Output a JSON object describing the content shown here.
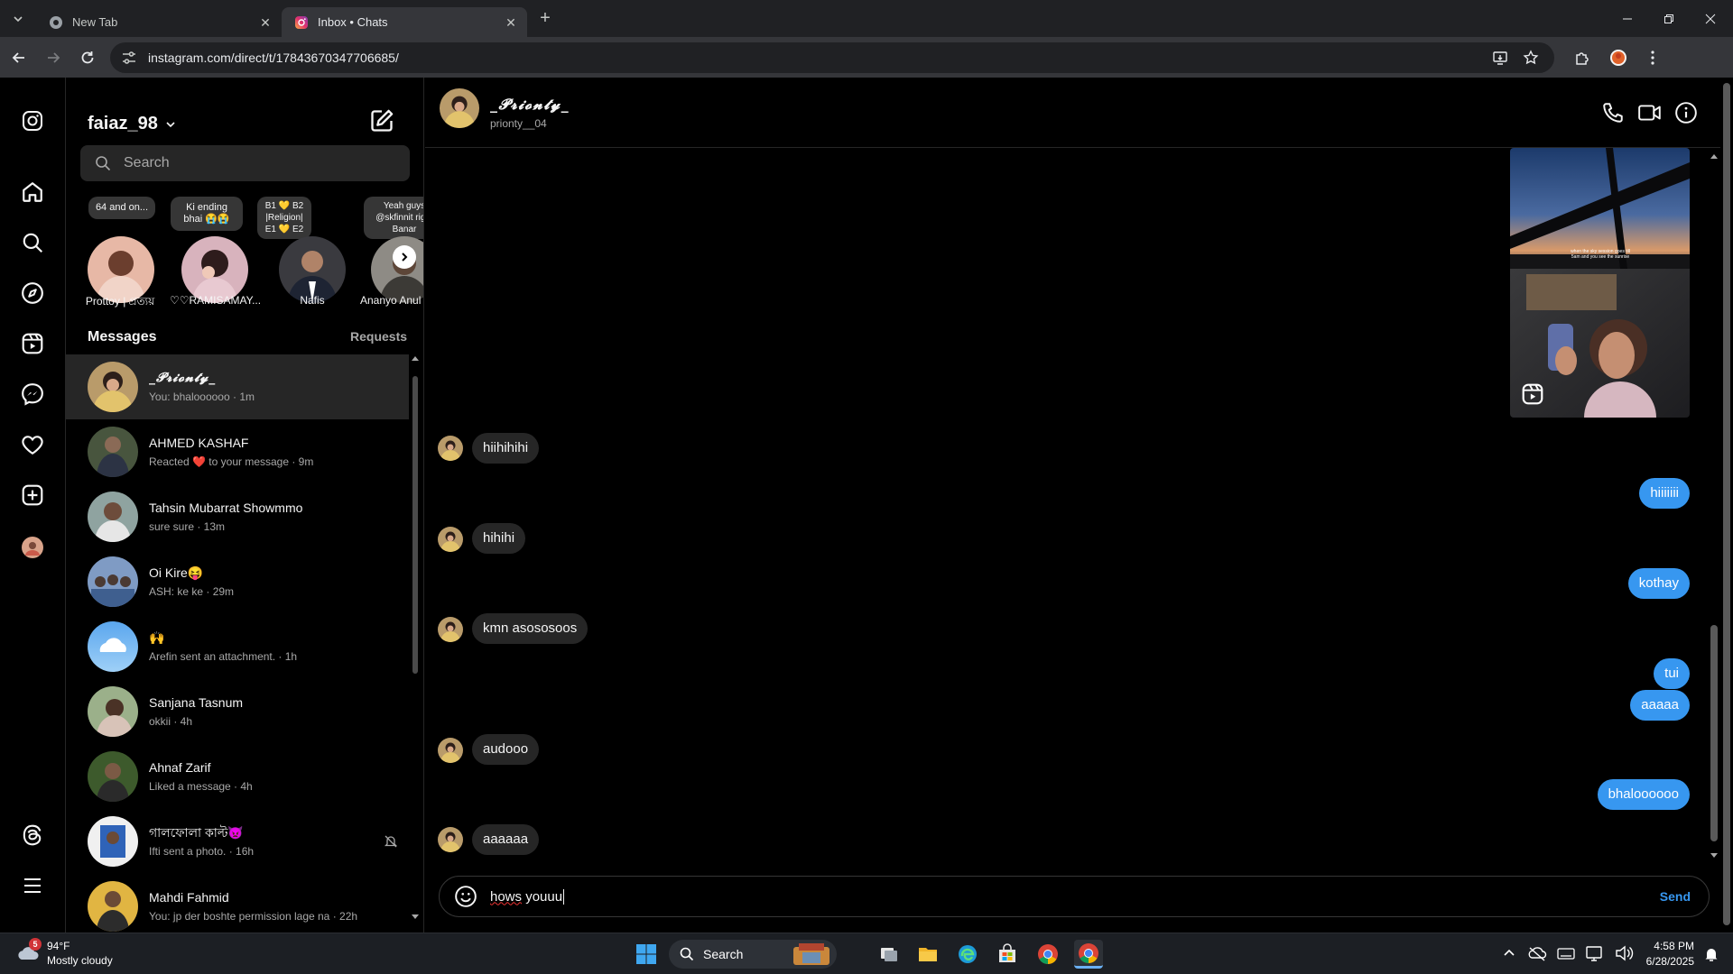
{
  "browser": {
    "tabs": [
      {
        "title": "New Tab",
        "active": false,
        "icon": "chrome-icon"
      },
      {
        "title": "Inbox • Chats",
        "active": true,
        "icon": "instagram-icon"
      }
    ],
    "url": "instagram.com/direct/t/17843670347706685/"
  },
  "inbox": {
    "account": "faiaz_98",
    "search_placeholder": "Search",
    "notes": [
      {
        "note": "64 and on...",
        "name": "Prottoy | প্রত্যয়"
      },
      {
        "note": "Ki ending bhai 😭😭",
        "name": "♡♡RAMISAMAY..."
      },
      {
        "note": "B1 💛 B2 |Religion| E1 💛 E2",
        "name": "Nafis"
      },
      {
        "note": "Yeah guys @skfinnit right Banar",
        "name": "Ananyo Anul"
      }
    ],
    "messages_label": "Messages",
    "requests_label": "Requests",
    "threads": [
      {
        "name": "_𝓟𝓻𝓲𝓸𝓷𝓽𝔂_",
        "sub": "You: bhaloooooo · 1m",
        "selected": true
      },
      {
        "name": "AHMED KASHAF",
        "sub": "Reacted ❤️ to your message · 9m"
      },
      {
        "name": "Tahsin Mubarrat Showmmo",
        "sub": "sure sure · 13m"
      },
      {
        "name": "Oi Kire😝",
        "sub": "ASH: ke ke · 29m"
      },
      {
        "name": "🙌",
        "sub": "Arefin sent an attachment. · 1h"
      },
      {
        "name": "Sanjana Tasnum",
        "sub": "okkii · 4h"
      },
      {
        "name": "Ahnaf Zarif",
        "sub": "Liked a message · 4h"
      },
      {
        "name": "গালফোলা কাল্ট👿",
        "sub": "Ifti sent a photo. · 16h",
        "muted": true
      },
      {
        "name": "Mahdi Fahmid",
        "sub": "You: jp der boshte permission lage na · 22h"
      }
    ]
  },
  "chat": {
    "header_name": "_𝓟𝓻𝓲𝓸𝓷𝓽𝔂_",
    "header_username": "prionty__04",
    "reel_caption": "when the sky session goes till 5am and you see the sunrise",
    "messages": [
      {
        "from": "them",
        "text": "hiihihihi"
      },
      {
        "from": "me",
        "text": "hiiiiiii"
      },
      {
        "from": "them",
        "text": "hihihi"
      },
      {
        "from": "me",
        "text": "kothay"
      },
      {
        "from": "them",
        "text": "kmn asososoos"
      },
      {
        "from": "me",
        "text": "tui"
      },
      {
        "from": "me",
        "text": "aaaaa"
      },
      {
        "from": "them",
        "text": "audooo"
      },
      {
        "from": "me",
        "text": "bhaloooooo"
      },
      {
        "from": "them",
        "text": "aaaaaa"
      }
    ],
    "composer_text_a": "hows",
    "composer_text_b": " youuu",
    "send_label": "Send"
  },
  "taskbar": {
    "weather_temp": "94°F",
    "weather_desc": "Mostly cloudy",
    "weather_badge": "5",
    "search_label": "Search",
    "time": "4:58 PM",
    "date": "6/28/2025"
  },
  "colors": {
    "accent": "#3797f0",
    "bubble_in": "#262626",
    "background": "#000000"
  }
}
